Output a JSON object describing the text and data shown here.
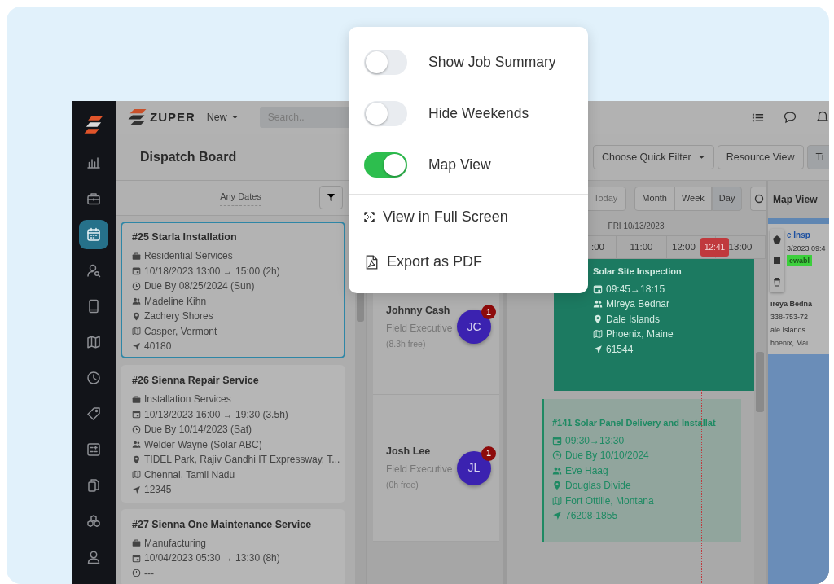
{
  "sidebar": {
    "items": [
      {
        "kind": "chart",
        "selected": false
      },
      {
        "kind": "briefcase",
        "selected": false
      },
      {
        "kind": "calendar",
        "selected": true
      },
      {
        "kind": "user-search",
        "selected": false
      },
      {
        "kind": "tablet",
        "selected": false
      },
      {
        "kind": "map",
        "selected": false
      },
      {
        "kind": "clock",
        "selected": false
      },
      {
        "kind": "tag",
        "selected": false
      },
      {
        "kind": "grid",
        "selected": false
      },
      {
        "kind": "documents",
        "selected": false
      },
      {
        "kind": "boxes",
        "selected": false
      },
      {
        "kind": "user",
        "selected": false
      }
    ]
  },
  "topbar": {
    "brand": "ZUPER",
    "new_menu": "New",
    "search": {
      "placeholder": "Search.."
    }
  },
  "page": {
    "title": "Dispatch Board"
  },
  "job_list": {
    "date_filter": "Any Dates",
    "jobs": [
      {
        "title": "#25 Starla Installation",
        "selected": true,
        "lines": [
          {
            "kind": "category",
            "text": "Residential Services"
          },
          {
            "kind": "schedule",
            "text": "10/18/2023 13:00 → 15:00 (2h)"
          },
          {
            "kind": "due",
            "text": "Due By 08/25/2024 (Sun)"
          },
          {
            "kind": "assignee",
            "text": "Madeline Kihn"
          },
          {
            "kind": "address",
            "text": "Zachery Shores"
          },
          {
            "kind": "city",
            "text": "Casper, Vermont"
          },
          {
            "kind": "zip",
            "text": "40180"
          }
        ]
      },
      {
        "title": "#26 Sienna Repair Service",
        "selected": false,
        "lines": [
          {
            "kind": "category",
            "text": "Installation Services"
          },
          {
            "kind": "schedule",
            "text": "10/13/2023 16:00 → 19:30 (3.5h)"
          },
          {
            "kind": "due",
            "text": "Due By 10/14/2023 (Sat)"
          },
          {
            "kind": "assignee",
            "text": "Welder Wayne (Solar ABC)"
          },
          {
            "kind": "address",
            "text": "TIDEL Park, Rajiv Gandhi IT Expressway, T..."
          },
          {
            "kind": "city",
            "text": "Chennai, Tamil Nadu"
          },
          {
            "kind": "zip",
            "text": "12345"
          }
        ]
      },
      {
        "title": "#27 Sienna One Maintenance Service",
        "selected": false,
        "lines": [
          {
            "kind": "category",
            "text": "Manufacturing"
          },
          {
            "kind": "schedule",
            "text": "10/04/2023 05:30 → 13:30 (8h)"
          },
          {
            "kind": "due",
            "text": "---"
          }
        ]
      }
    ]
  },
  "toolbar": {
    "quick_filter": "Choose Quick Filter",
    "buttons": [
      {
        "label": "Resource View",
        "selected": false
      },
      {
        "label": "Ti",
        "selected": true
      }
    ]
  },
  "calendar": {
    "today": "Today",
    "views": [
      {
        "label": "Month",
        "selected": false
      },
      {
        "label": "Week",
        "selected": false
      },
      {
        "label": "Day",
        "selected": true
      }
    ],
    "date": "FRI 10/13/2023",
    "hours": [
      ":00",
      "11:00",
      "12:00",
      "13:00"
    ],
    "now": "12:41",
    "resources": [
      {
        "name": "Johnny Cash",
        "role": "Field Executive",
        "free": "(8.3h free)",
        "initials": "JC",
        "badge": "1",
        "events": [
          {
            "kind": "confirmed",
            "title": "Solar Site Inspection",
            "lines": [
              {
                "kind": "schedule",
                "text": "09:45→18:15"
              },
              {
                "kind": "assignee",
                "text": "Mireya Bednar"
              },
              {
                "kind": "address",
                "text": "Dale Islands"
              },
              {
                "kind": "city",
                "text": "Phoenix, Maine"
              },
              {
                "kind": "zip",
                "text": "61544"
              }
            ]
          }
        ]
      },
      {
        "name": "Josh Lee",
        "role": "Field Executive",
        "free": "(0h free)",
        "initials": "JL",
        "badge": "1",
        "events": [
          {
            "kind": "tentative",
            "title": "#141 Solar Panel Delivery and Installat",
            "lines": [
              {
                "kind": "schedule",
                "text": "09:30→13:30"
              },
              {
                "kind": "due",
                "text": "Due By 10/10/2024"
              },
              {
                "kind": "assignee",
                "text": "Eve Haag"
              },
              {
                "kind": "address",
                "text": "Douglas Divide"
              },
              {
                "kind": "city",
                "text": "Fort Ottilie, Montana"
              },
              {
                "kind": "zip",
                "text": "76208-1855"
              }
            ]
          }
        ]
      }
    ]
  },
  "map": {
    "title": "Map View",
    "card": {
      "title": "e Insp",
      "time": "3/2023 09:4",
      "tag": "ewabl",
      "name": "ireya Bedna",
      "phone": "338-753-72",
      "address": "ale Islands",
      "city": "hoenix, Mai"
    }
  },
  "menu": {
    "toggles": [
      {
        "label": "Show Job Summary",
        "on": false
      },
      {
        "label": "Hide Weekends",
        "on": false
      },
      {
        "label": "Map View",
        "on": true
      }
    ],
    "actions": [
      {
        "kind": "fullscreen",
        "label": "View in Full Screen"
      },
      {
        "kind": "pdf",
        "label": "Export as PDF"
      }
    ]
  }
}
